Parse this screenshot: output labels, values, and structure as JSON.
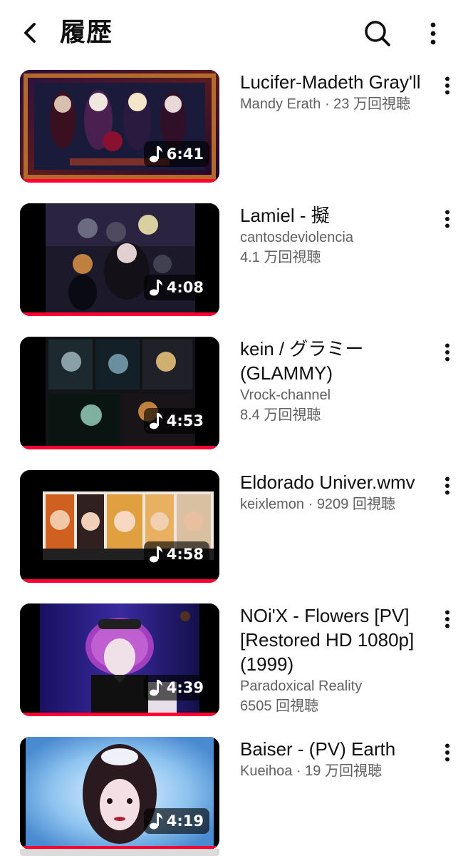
{
  "header": {
    "title": "履歴",
    "back_icon": "back-arrow-icon",
    "search_icon": "search-icon",
    "more_icon": "more-vert-icon"
  },
  "accent_color": "#ff0033",
  "videos": [
    {
      "title": "Lucifer-Madeth Gray'll",
      "sub1": "Mandy Erath · 23 万回視聴",
      "sub2": "",
      "duration": "6:41",
      "watched_fraction": 1.0
    },
    {
      "title": "Lamiel - 擬",
      "sub1": "cantosdeviolencia",
      "sub2": "4.1 万回視聴",
      "duration": "4:08",
      "watched_fraction": 1.0
    },
    {
      "title": "kein / グラミー (GLAMMY)",
      "sub1": "Vrock-channel",
      "sub2": "8.4 万回視聴",
      "duration": "4:53",
      "watched_fraction": 1.0
    },
    {
      "title": "Eldorado Univer.wmv",
      "sub1": "keixlemon · 9209 回視聴",
      "sub2": "",
      "duration": "4:58",
      "watched_fraction": 1.0
    },
    {
      "title": "NOi'X - Flowers [PV] [Restored HD 1080p] (1999)",
      "sub1": "Paradoxical Reality",
      "sub2": "6505 回視聴",
      "duration": "4:39",
      "watched_fraction": 1.0
    },
    {
      "title": "Baiser - (PV) Earth",
      "sub1": "Kueihoa · 19 万回視聴",
      "sub2": "",
      "duration": "4:19",
      "watched_fraction": 1.0
    }
  ]
}
